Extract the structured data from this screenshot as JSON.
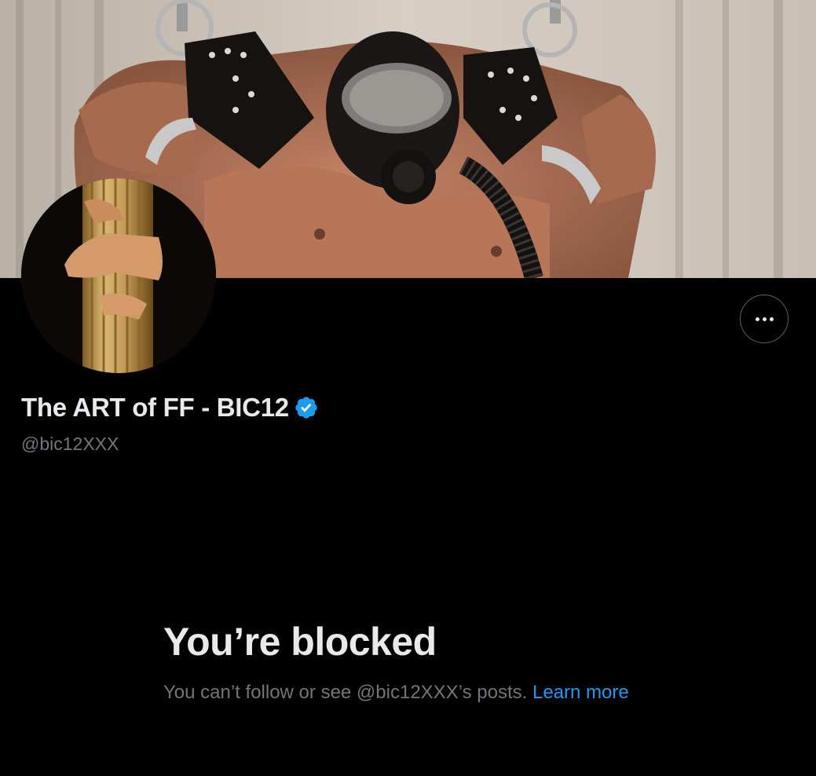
{
  "profile": {
    "display_name": "The ART of FF - BIC12",
    "handle": "@bic12XXX",
    "verified": true,
    "banner_image": "leather-harness-gas-mask-photo",
    "avatar_image": "hands-embracing-wooden-column"
  },
  "actions": {
    "more_icon": "more-horizontal-icon"
  },
  "blocked": {
    "title": "You’re blocked",
    "message": "You can’t follow or see @bic12XXX’s posts. ",
    "learn_more": "Learn more"
  },
  "colors": {
    "background": "#000000",
    "text_primary": "#e7e9ea",
    "text_secondary": "#71767b",
    "accent": "#1d9bf0",
    "border": "#536471"
  }
}
